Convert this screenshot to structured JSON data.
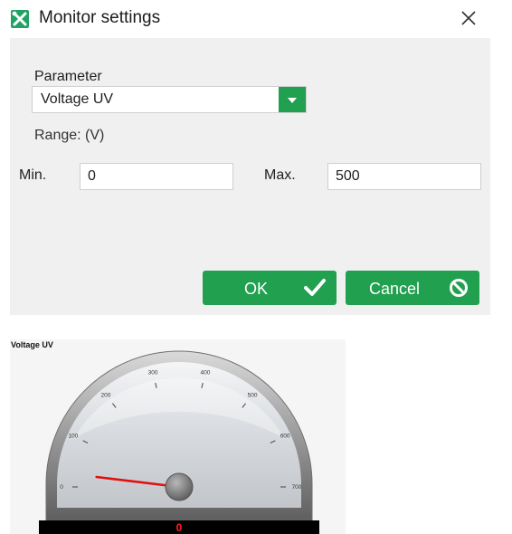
{
  "dialog": {
    "title": "Monitor settings",
    "parameter_label": "Parameter",
    "parameter_value": "Voltage UV",
    "range_label": "Range: (V)",
    "min_label": "Min.",
    "min_value": "0",
    "max_label": "Max.",
    "max_value": "500",
    "ok_label": "OK",
    "cancel_label": "Cancel"
  },
  "icons": {
    "app": "tools-icon",
    "close": "close-icon",
    "dropdown": "chevron-down-icon",
    "ok": "checkmark-icon",
    "cancel": "prohibited-icon"
  },
  "gauge": {
    "title": "Voltage UV",
    "ticks": [
      "0",
      "100",
      "200",
      "300",
      "400",
      "500",
      "600",
      "700"
    ],
    "min": 0,
    "max": 700,
    "value": 0,
    "value_display": "0"
  },
  "colors": {
    "accent": "#21a04f",
    "needle": "#e01010",
    "value_text": "#ff2020"
  }
}
